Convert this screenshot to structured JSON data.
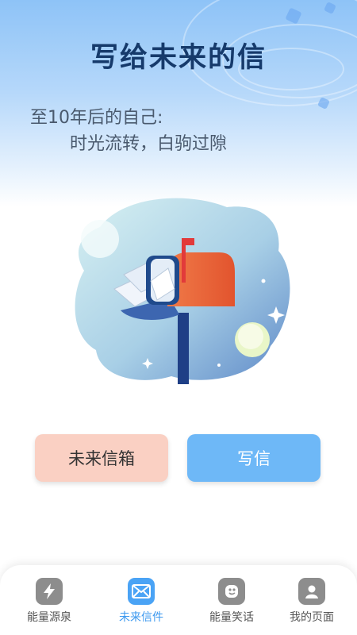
{
  "page": {
    "title": "写给未来的信",
    "letter_line1": "至10年后的自己:",
    "letter_line2": "时光流转，白驹过隙"
  },
  "illustration": {
    "subject": "mailbox-with-letters",
    "colors": {
      "mailbox": "#e8643a",
      "flag": "#e23a3a",
      "post": "#1f3f86",
      "blob": "#9fc8e3"
    }
  },
  "buttons": {
    "mailbox_label": "未来信箱",
    "write_label": "写信"
  },
  "tabbar": {
    "items": [
      {
        "label": "能量源泉",
        "icon": "lightning-icon",
        "active": false
      },
      {
        "label": "未来信件",
        "icon": "envelope-icon",
        "active": true
      },
      {
        "label": "能量笑话",
        "icon": "smile-icon",
        "active": false
      },
      {
        "label": "我的页面",
        "icon": "person-icon",
        "active": false
      }
    ]
  },
  "colors": {
    "accent": "#4aa3f5",
    "title": "#163a6b",
    "button_pink": "#fad0c3",
    "button_blue": "#6eb8f7"
  }
}
